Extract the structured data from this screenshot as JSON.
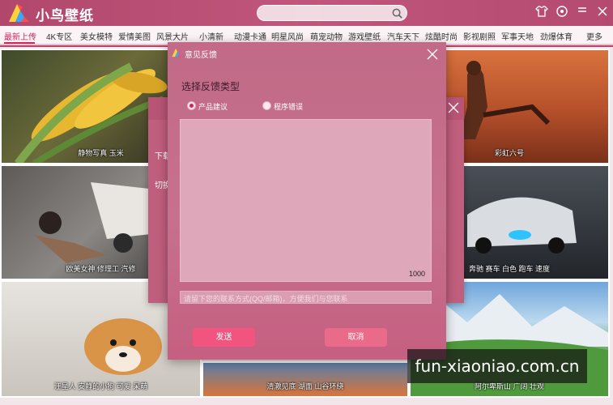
{
  "app": {
    "title": "小鸟壁纸",
    "watermark": "fun-xiaoniao.com.cn",
    "accent_color": "#d0275d",
    "brand_color": "#b8456a"
  },
  "search": {
    "placeholder": "",
    "icon": "search-icon"
  },
  "window_controls": [
    "shirt-icon",
    "settings-icon",
    "menu-icon",
    "minimize-icon",
    "close-icon"
  ],
  "nav": {
    "items": [
      "最新上传",
      "4K专区",
      "美女模特",
      "爱情美图",
      "风景大片",
      "小清新",
      "动漫卡通",
      "明星风尚",
      "萌宠动物",
      "游戏壁纸",
      "汽车天下",
      "炫酷时尚",
      "影视剧照",
      "军事天地",
      "劲爆体育",
      "更多"
    ],
    "active_index": 0
  },
  "tiles": [
    {
      "caption": "静物写真 玉米"
    },
    {
      "caption": "彩虹六号"
    },
    {
      "caption": "欧美女神 修理工 汽修"
    },
    {
      "caption": "奔驰 赛车 白色 跑车 速度"
    },
    {
      "caption": "汪星人 安静的小狗 可爱 呆萌"
    },
    {
      "caption": "清澈见底 湖面 山谷环绕"
    },
    {
      "caption": "阿尔卑斯山 广阔 壮观"
    }
  ],
  "back_dialog": {
    "line1": "下载",
    "line2": "切换"
  },
  "feedback_dialog": {
    "title": "意见反馈",
    "heading": "选择反馈类型",
    "options": [
      {
        "label": "产品建议",
        "checked": true
      },
      {
        "label": "程序错误",
        "checked": false
      }
    ],
    "content_value": "",
    "char_count": "1000",
    "contact_placeholder": "请留下您的联系方式(QQ/邮箱)，方便我们与您联系",
    "send_label": "发送",
    "cancel_label": "取消"
  }
}
